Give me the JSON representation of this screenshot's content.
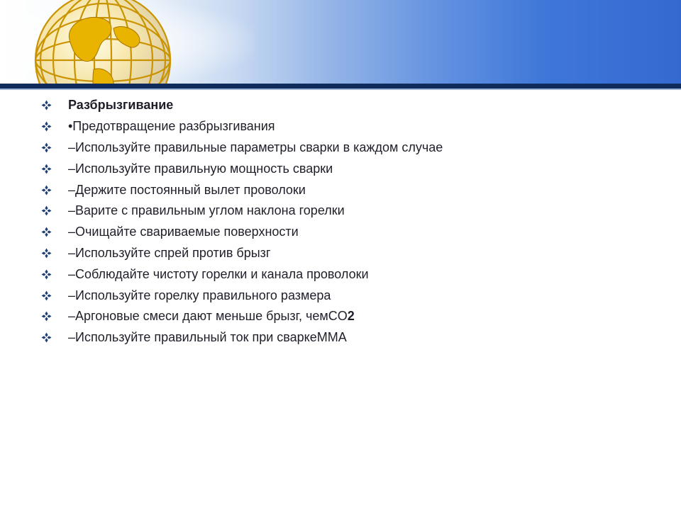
{
  "slide": {
    "accent_color": "#1f3f73",
    "header_colors": {
      "rule": "#0f2c5c",
      "banner_end": "#3569d0"
    },
    "bullet_icon": "diamond-bullet-icon",
    "items": [
      {
        "text": "Разбрызгивание",
        "style": "heading"
      },
      {
        "text": "•Предотвращение разбрызгивания",
        "style": "normal"
      },
      {
        "text": "–Используйте правильные параметры сварки в каждом случае",
        "style": "normal"
      },
      {
        "text": "–Используйте правильную мощность сварки",
        "style": "normal"
      },
      {
        "text": "–Держите постоянный вылет проволоки",
        "style": "normal"
      },
      {
        "text": "–Варите с правильным углом наклона горелки",
        "style": "normal"
      },
      {
        "text": "–Очищайте свариваемые поверхности",
        "style": "normal"
      },
      {
        "text": "–Используйте спрей против брызг",
        "style": "normal"
      },
      {
        "text": "–Соблюдайте чистоту горелки и канала проволоки",
        "style": "normal"
      },
      {
        "text": "–Используйте горелку правильного размера",
        "style": "normal"
      },
      {
        "text": "–Аргоновые смеси дают меньше брызг, чемCO",
        "suffix": "2",
        "style": "normal"
      },
      {
        "text": "–Используйте правильный ток при сваркеMMA",
        "style": "normal"
      }
    ]
  }
}
